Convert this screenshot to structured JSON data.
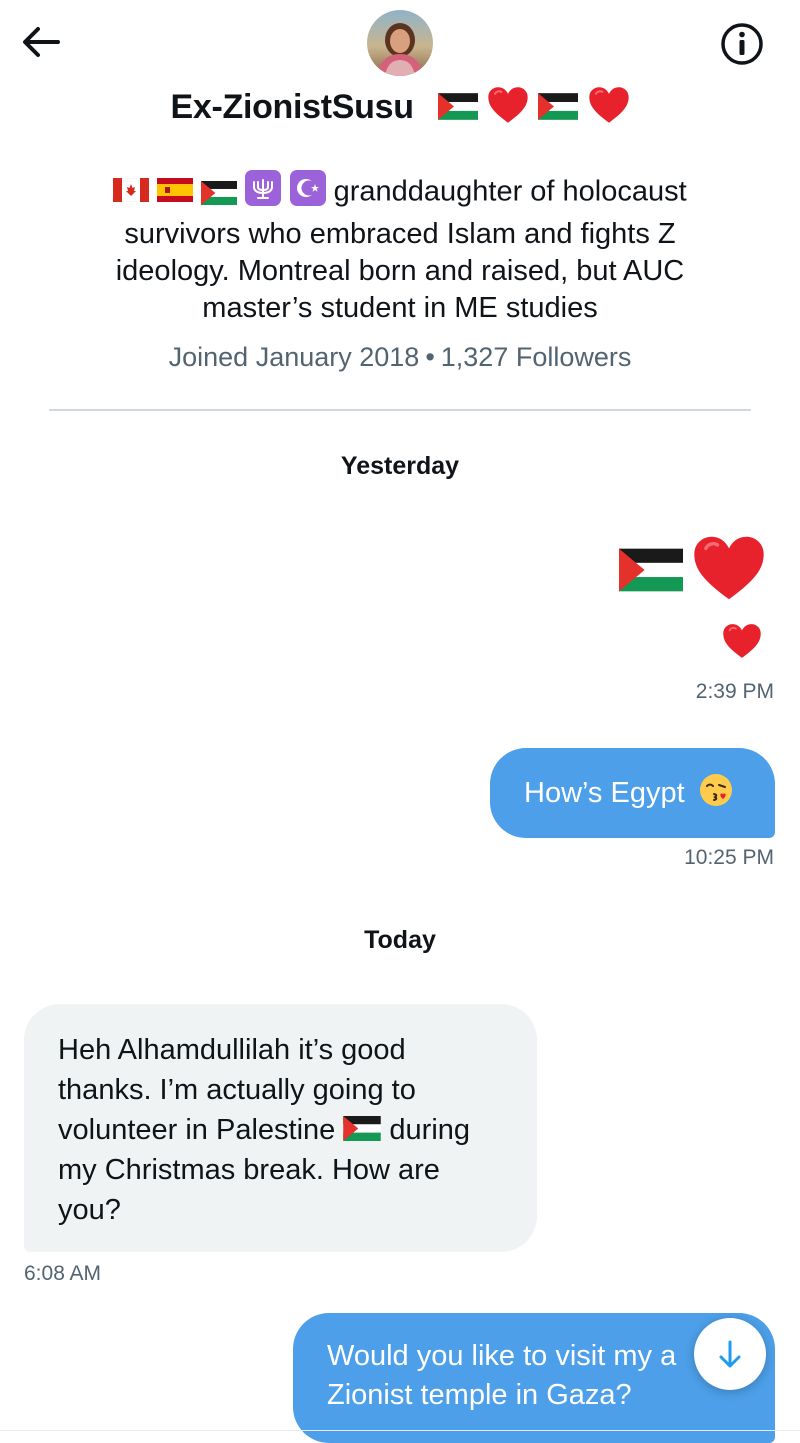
{
  "header": {
    "display_name": "Ex-ZionistSusu",
    "bio_text_line1": "granddaughter of holocaust",
    "bio_text_rest": "survivors who embraced Islam and fights Z ideology. Montreal born and raised, but AUC master’s student in ME studies",
    "joined": "Joined January 2018",
    "separator": "•",
    "followers": "1,327 Followers",
    "name_emojis": [
      "palestine-flag",
      "red-heart",
      "palestine-flag",
      "red-heart"
    ],
    "bio_emojis": [
      "canada-flag",
      "spain-flag",
      "palestine-flag",
      "menorah-icon",
      "star-and-crescent-icon"
    ]
  },
  "conversation": {
    "sections": [
      {
        "date": "Yesterday",
        "messages": [
          {
            "from": "me",
            "content": [
              "palestine-flag",
              "red-heart",
              "red-heart"
            ],
            "time": "2:39 PM"
          },
          {
            "from": "me",
            "text": "How’s Egypt",
            "emoji": "kissing-face",
            "time": "10:25 PM"
          }
        ]
      },
      {
        "date": "Today",
        "messages": [
          {
            "from": "them",
            "line1": "Heh Alhamdullilah it’s good",
            "line2": "thanks. I’m actually going to",
            "line3a": "volunteer in Palestine",
            "line3b": "during",
            "line4": "my Christmas break. How are",
            "line5": "you?",
            "time": "6:08 AM"
          },
          {
            "from": "me",
            "line1": "Would you like to visit my a",
            "line2": "Zionist temple in Gaza?"
          }
        ]
      }
    ]
  },
  "colors": {
    "accent_bubble": "#4c9fe8",
    "incoming_bubble": "#eff3f4",
    "secondary_text": "#536471",
    "heart_red": "#e8222c"
  }
}
